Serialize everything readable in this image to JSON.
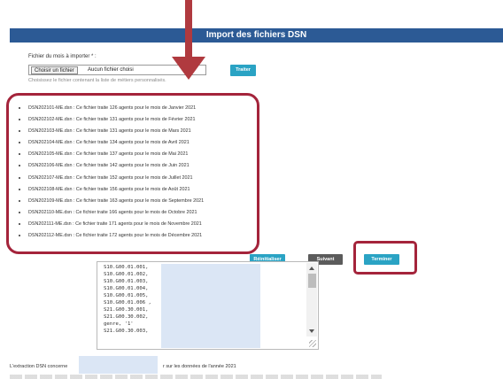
{
  "header": {
    "title": "Import des fichiers DSN"
  },
  "file_section": {
    "label": "Fichier du mois à importer * :",
    "choose_button": "Choisir un fichier",
    "no_file": "Aucun fichier choisi",
    "hint": "Choisissez le fichier contenant la liste de métiers personnalisés."
  },
  "buttons": {
    "process": "Traiter",
    "reset": "Réinitialiser",
    "next": "Suivant",
    "finish": "Terminer"
  },
  "files": [
    "DSN202101-ME.dsn : Ce fichier traite 126 agents pour le mois de Janvier 2021",
    "DSN202102-ME.dsn : Ce fichier traite 131 agents pour le mois de Février 2021",
    "DSN202103-ME.dsn : Ce fichier traite 131 agents pour le mois de Mars 2021",
    "DSN202104-ME.dsn : Ce fichier traite 134 agents pour le mois de Avril 2021",
    "DSN202105-ME.dsn : Ce fichier traite 137 agents pour le mois de Mai 2021",
    "DSN202106-ME.dsn : Ce fichier traite 142 agents pour le mois de Juin 2021",
    "DSN202107-ME.dsn : Ce fichier traite 152 agents pour le mois de Juillet 2021",
    "DSN202108-ME.dsn : Ce fichier traite 156 agents pour le mois de Août 2021",
    "DSN202109-ME.dsn : Ce fichier traite 163 agents pour le mois de Septembre 2021",
    "DSN202110-ME.dsn : Ce fichier traite 166 agents pour le mois de Octobre 2021",
    "DSN202111-ME.dsn : Ce fichier traite 171 agents pour le mois de Novembre 2021",
    "DSN202112-ME.dsn : Ce fichier traite 172 agents pour le mois de Décembre 2021"
  ],
  "code_lines": "S10.G00.01.001,\nS10.G00.01.002,\nS10.G00.01.003,\nS10.G00.01.004,\nS10.G00.01.005,\nS10.G00.01.006 ,\nS21.G00.30.001,\nS21.G00.30.002,\ngenre, '1'\nS21.G00.30.003,",
  "footer": {
    "prefix": "L'extraction DSN concerne",
    "suffix": "r sur les données de l'année 2021"
  },
  "colors": {
    "header": "#2c5a95",
    "primary_button": "#2aa3c4",
    "secondary_button": "#5b5b5b",
    "annotation": "#a4243b"
  }
}
